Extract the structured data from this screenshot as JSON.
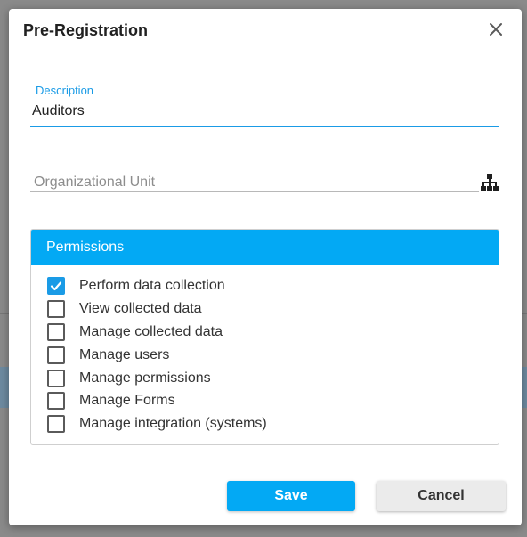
{
  "dialog": {
    "title": "Pre-Registration",
    "close_icon": "close-icon"
  },
  "description": {
    "label": "Description",
    "value": "Auditors"
  },
  "org_unit": {
    "placeholder": "Organizational Unit",
    "value": "",
    "icon": "org-chart-icon"
  },
  "permissions": {
    "header": "Permissions",
    "items": [
      {
        "label": "Perform data collection",
        "checked": true
      },
      {
        "label": "View collected data",
        "checked": false
      },
      {
        "label": "Manage collected data",
        "checked": false
      },
      {
        "label": "Manage users",
        "checked": false
      },
      {
        "label": "Manage permissions",
        "checked": false
      },
      {
        "label": "Manage Forms",
        "checked": false
      },
      {
        "label": "Manage integration (systems)",
        "checked": false
      }
    ]
  },
  "buttons": {
    "save_label": "Save",
    "cancel_label": "Cancel"
  },
  "colors": {
    "accent": "#03a9f4",
    "field_focus": "#1a9be6",
    "overlay": "#7d7d7d"
  }
}
